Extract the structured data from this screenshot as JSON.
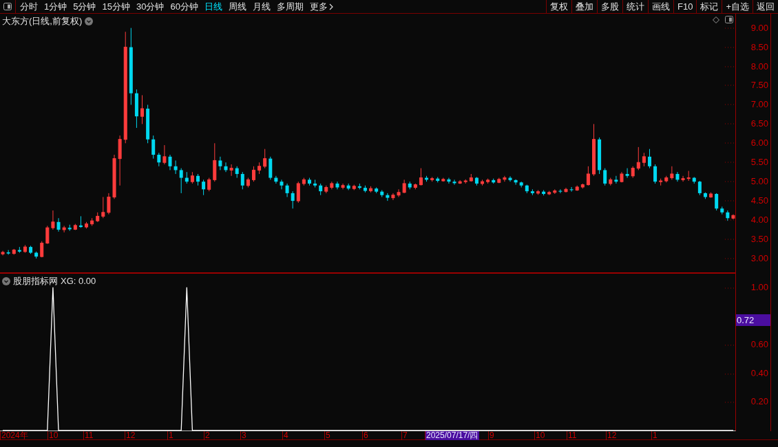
{
  "toolbar": {
    "periods": [
      {
        "label": "分时",
        "selected": false
      },
      {
        "label": "1分钟",
        "selected": false
      },
      {
        "label": "5分钟",
        "selected": false
      },
      {
        "label": "15分钟",
        "selected": false
      },
      {
        "label": "30分钟",
        "selected": false
      },
      {
        "label": "60分钟",
        "selected": false
      },
      {
        "label": "日线",
        "selected": true
      },
      {
        "label": "周线",
        "selected": false
      },
      {
        "label": "月线",
        "selected": false
      },
      {
        "label": "多周期",
        "selected": false
      }
    ],
    "more": "更多",
    "actions": [
      "复权",
      "叠加",
      "多股",
      "统计",
      "画线",
      "F10",
      "标记",
      "+自选",
      "返回"
    ]
  },
  "chart": {
    "title": "大东方(日线,前复权)",
    "chart_data": {
      "type": "candlestick",
      "ylim": [
        2.64,
        9.37
      ],
      "categories": [
        null,
        null,
        null,
        null,
        null,
        null,
        null,
        null,
        null,
        null,
        null,
        null,
        null,
        null,
        null,
        null,
        null,
        null,
        null,
        null,
        null,
        null,
        null,
        null,
        null,
        null,
        null,
        null,
        null,
        null,
        null,
        null,
        null,
        null,
        null,
        null,
        null,
        null,
        null,
        null,
        null,
        null,
        null,
        null,
        null,
        null,
        null,
        null,
        null,
        null,
        null,
        null,
        null,
        null,
        null,
        null,
        null,
        null,
        null,
        null,
        null,
        null,
        null,
        null,
        null,
        null,
        null,
        null,
        null,
        null,
        null,
        null,
        null,
        null,
        null,
        null,
        null,
        null,
        null,
        null,
        null,
        null,
        null,
        null,
        null,
        null,
        null,
        null,
        null,
        null,
        null,
        null,
        null,
        null,
        null,
        null,
        null,
        null,
        null,
        null,
        null,
        null,
        null,
        null,
        null,
        null,
        null,
        null,
        null,
        null,
        null,
        null,
        null,
        null,
        null,
        null,
        null,
        null,
        null,
        null,
        null,
        null,
        null,
        null,
        null,
        null,
        null,
        null,
        null,
        null,
        null,
        null
      ],
      "yticks": [
        {
          "value": 9,
          "label": "9.00"
        },
        {
          "value": 8.5,
          "label": "8.50"
        },
        {
          "value": 8,
          "label": "8.00"
        },
        {
          "value": 7.5,
          "label": "7.50"
        },
        {
          "value": 7,
          "label": "7.00"
        },
        {
          "value": 6.5,
          "label": "6.50"
        },
        {
          "value": 6,
          "label": "6.00"
        },
        {
          "value": 5.5,
          "label": "5.50"
        },
        {
          "value": 5,
          "label": "5.00"
        },
        {
          "value": 4.5,
          "label": "4.50"
        },
        {
          "value": 4,
          "label": "4.00"
        },
        {
          "value": 3.5,
          "label": "3.50"
        },
        {
          "value": 3,
          "label": "3.00"
        }
      ],
      "ohlc": [
        [
          3.12,
          3.2,
          3.08,
          3.16
        ],
        [
          3.16,
          3.22,
          3.1,
          3.13
        ],
        [
          3.13,
          3.25,
          3.1,
          3.22
        ],
        [
          3.22,
          3.3,
          3.15,
          3.18
        ],
        [
          3.18,
          3.35,
          3.15,
          3.3
        ],
        [
          3.3,
          3.33,
          3.12,
          3.15
        ],
        [
          3.15,
          3.18,
          3.0,
          3.05
        ],
        [
          3.05,
          3.45,
          3.03,
          3.4
        ],
        [
          3.4,
          3.85,
          3.38,
          3.8
        ],
        [
          3.8,
          4.25,
          3.75,
          3.95
        ],
        [
          3.95,
          4.05,
          3.7,
          3.75
        ],
        [
          3.75,
          3.85,
          3.68,
          3.8
        ],
        [
          3.8,
          3.88,
          3.72,
          3.76
        ],
        [
          3.76,
          3.9,
          3.74,
          3.86
        ],
        [
          3.86,
          4.1,
          3.8,
          3.82
        ],
        [
          3.82,
          3.95,
          3.78,
          3.9
        ],
        [
          3.9,
          4.05,
          3.85,
          3.98
        ],
        [
          3.98,
          4.2,
          3.95,
          4.1
        ],
        [
          4.1,
          4.6,
          4.05,
          4.2
        ],
        [
          4.2,
          4.7,
          4.15,
          4.6
        ],
        [
          4.6,
          5.7,
          4.55,
          5.6
        ],
        [
          5.6,
          6.2,
          4.9,
          6.1
        ],
        [
          6.1,
          8.9,
          6.0,
          8.5
        ],
        [
          8.5,
          9.0,
          7.0,
          7.3
        ],
        [
          7.3,
          7.4,
          6.4,
          6.7
        ],
        [
          6.7,
          7.25,
          6.5,
          6.9
        ],
        [
          6.9,
          7.0,
          6.0,
          6.1
        ],
        [
          6.1,
          6.2,
          5.6,
          5.7
        ],
        [
          5.7,
          5.75,
          5.4,
          5.5
        ],
        [
          5.5,
          5.95,
          5.45,
          5.65
        ],
        [
          5.65,
          5.7,
          5.3,
          5.4
        ],
        [
          5.4,
          5.55,
          5.2,
          5.3
        ],
        [
          5.3,
          5.35,
          4.7,
          5.1
        ],
        [
          5.1,
          5.25,
          4.95,
          5.0
        ],
        [
          5.0,
          5.25,
          4.95,
          5.15
        ],
        [
          5.15,
          5.2,
          4.9,
          5.0
        ],
        [
          5.0,
          5.05,
          4.65,
          4.8
        ],
        [
          4.8,
          5.1,
          4.75,
          5.05
        ],
        [
          5.05,
          6.0,
          5.0,
          5.55
        ],
        [
          5.55,
          5.65,
          5.3,
          5.4
        ],
        [
          5.4,
          5.5,
          5.25,
          5.3
        ],
        [
          5.3,
          5.45,
          5.15,
          5.35
        ],
        [
          5.35,
          5.4,
          5.1,
          5.2
        ],
        [
          5.2,
          5.25,
          4.8,
          4.9
        ],
        [
          4.9,
          5.1,
          4.85,
          5.05
        ],
        [
          5.05,
          5.4,
          5.0,
          5.3
        ],
        [
          5.3,
          5.5,
          5.2,
          5.4
        ],
        [
          5.4,
          5.85,
          5.35,
          5.6
        ],
        [
          5.6,
          5.65,
          5.05,
          5.1
        ],
        [
          5.1,
          5.15,
          4.95,
          5.0
        ],
        [
          5.0,
          5.05,
          4.8,
          4.9
        ],
        [
          4.9,
          4.95,
          4.6,
          4.7
        ],
        [
          4.7,
          4.75,
          4.3,
          4.5
        ],
        [
          4.5,
          5.0,
          4.45,
          4.95
        ],
        [
          4.95,
          5.1,
          4.9,
          5.05
        ],
        [
          5.05,
          5.1,
          4.9,
          4.95
        ],
        [
          4.95,
          5.05,
          4.85,
          4.9
        ],
        [
          4.9,
          4.95,
          4.65,
          4.75
        ],
        [
          4.75,
          4.9,
          4.7,
          4.85
        ],
        [
          4.85,
          5.0,
          4.8,
          4.95
        ],
        [
          4.95,
          5.0,
          4.8,
          4.85
        ],
        [
          4.85,
          4.95,
          4.8,
          4.9
        ],
        [
          4.9,
          4.95,
          4.78,
          4.82
        ],
        [
          4.82,
          4.92,
          4.78,
          4.88
        ],
        [
          4.88,
          4.95,
          4.8,
          4.84
        ],
        [
          4.84,
          4.9,
          4.72,
          4.76
        ],
        [
          4.76,
          4.88,
          4.72,
          4.82
        ],
        [
          4.82,
          4.85,
          4.7,
          4.74
        ],
        [
          4.74,
          4.78,
          4.6,
          4.65
        ],
        [
          4.65,
          4.7,
          4.5,
          4.58
        ],
        [
          4.58,
          4.7,
          4.52,
          4.65
        ],
        [
          4.65,
          4.8,
          4.6,
          4.72
        ],
        [
          4.72,
          5.05,
          4.7,
          4.95
        ],
        [
          4.95,
          5.0,
          4.8,
          4.85
        ],
        [
          4.85,
          4.95,
          4.8,
          4.92
        ],
        [
          4.92,
          5.35,
          4.9,
          5.1
        ],
        [
          5.1,
          5.15,
          5.0,
          5.05
        ],
        [
          5.05,
          5.12,
          5.0,
          5.08
        ],
        [
          5.08,
          5.12,
          4.98,
          5.02
        ],
        [
          5.02,
          5.1,
          5.0,
          5.06
        ],
        [
          5.06,
          5.1,
          4.95,
          5.0
        ],
        [
          5.0,
          5.05,
          4.92,
          4.96
        ],
        [
          4.96,
          5.04,
          4.94,
          5.0
        ],
        [
          5.0,
          5.06,
          4.95,
          5.02
        ],
        [
          5.02,
          5.2,
          5.0,
          5.1
        ],
        [
          5.1,
          5.12,
          4.9,
          4.95
        ],
        [
          4.95,
          5.05,
          4.9,
          5.0
        ],
        [
          5.0,
          5.08,
          4.95,
          5.04
        ],
        [
          5.04,
          5.08,
          4.95,
          4.98
        ],
        [
          4.98,
          5.1,
          4.96,
          5.06
        ],
        [
          5.06,
          5.15,
          5.0,
          5.1
        ],
        [
          5.1,
          5.14,
          5.0,
          5.04
        ],
        [
          5.04,
          5.06,
          4.92,
          4.98
        ],
        [
          4.98,
          5.0,
          4.85,
          4.9
        ],
        [
          4.9,
          4.92,
          4.7,
          4.75
        ],
        [
          4.75,
          4.8,
          4.65,
          4.7
        ],
        [
          4.7,
          4.78,
          4.66,
          4.74
        ],
        [
          4.74,
          4.78,
          4.64,
          4.68
        ],
        [
          4.68,
          4.76,
          4.65,
          4.72
        ],
        [
          4.72,
          4.8,
          4.68,
          4.76
        ],
        [
          4.76,
          4.8,
          4.7,
          4.74
        ],
        [
          4.74,
          4.84,
          4.72,
          4.8
        ],
        [
          4.8,
          4.86,
          4.74,
          4.78
        ],
        [
          4.78,
          4.9,
          4.76,
          4.86
        ],
        [
          4.86,
          4.95,
          4.82,
          4.92
        ],
        [
          4.92,
          5.4,
          4.9,
          5.2
        ],
        [
          5.2,
          6.5,
          5.15,
          6.1
        ],
        [
          6.1,
          6.15,
          5.2,
          5.3
        ],
        [
          5.3,
          5.35,
          4.9,
          4.95
        ],
        [
          4.95,
          5.1,
          4.9,
          5.05
        ],
        [
          5.05,
          5.15,
          4.95,
          5.0
        ],
        [
          5.0,
          5.25,
          4.98,
          5.2
        ],
        [
          5.2,
          5.35,
          5.1,
          5.15
        ],
        [
          5.15,
          5.4,
          5.1,
          5.35
        ],
        [
          5.35,
          5.9,
          5.3,
          5.5
        ],
        [
          5.5,
          5.75,
          5.4,
          5.65
        ],
        [
          5.65,
          5.85,
          5.35,
          5.4
        ],
        [
          5.4,
          5.45,
          4.95,
          5.0
        ],
        [
          5.0,
          5.08,
          4.9,
          5.02
        ],
        [
          5.02,
          5.15,
          4.98,
          5.1
        ],
        [
          5.1,
          5.4,
          5.05,
          5.2
        ],
        [
          5.2,
          5.25,
          5.0,
          5.05
        ],
        [
          5.05,
          5.15,
          5.0,
          5.08
        ],
        [
          5.08,
          5.28,
          5.02,
          5.1
        ],
        [
          5.1,
          5.12,
          4.95,
          5.0
        ],
        [
          5.0,
          5.02,
          4.65,
          4.7
        ],
        [
          4.7,
          4.72,
          4.55,
          4.6
        ],
        [
          4.6,
          4.72,
          4.58,
          4.68
        ],
        [
          4.68,
          4.7,
          4.25,
          4.3
        ],
        [
          4.3,
          4.35,
          4.15,
          4.2
        ],
        [
          4.2,
          4.25,
          3.98,
          4.05
        ],
        [
          4.05,
          4.15,
          4.02,
          4.12
        ]
      ]
    }
  },
  "indicator": {
    "name": "股朋指标网",
    "readout": "XG: 0.00",
    "cursor_value": "0.72",
    "chart_data": {
      "type": "line",
      "ylim": [
        0,
        1.095
      ],
      "yticks": [
        {
          "value": 1,
          "label": "1.00"
        },
        {
          "value": 0.6,
          "label": "0.60"
        },
        {
          "value": 0.4,
          "label": "0.40"
        },
        {
          "value": 0.2,
          "label": "0.20"
        }
      ],
      "series": [
        {
          "color": "#ffffff",
          "values": [
            0,
            0,
            0,
            0,
            0,
            0,
            0,
            0,
            0,
            1,
            0,
            0,
            0,
            0,
            0,
            0,
            0,
            0,
            0,
            0,
            0,
            0,
            0,
            0,
            0,
            0,
            0,
            0,
            0,
            0,
            0,
            0,
            0,
            1,
            0,
            0,
            0,
            0,
            0,
            0,
            0,
            0,
            0,
            0,
            0,
            0,
            0,
            0,
            0,
            0,
            0,
            0,
            0,
            0,
            0,
            0,
            0,
            0,
            0,
            0,
            0,
            0,
            0,
            0,
            0,
            0,
            0,
            0,
            0,
            0,
            0,
            0,
            0,
            0,
            0,
            0,
            0,
            0,
            0,
            0,
            0,
            0,
            0,
            0,
            0,
            0,
            0,
            0,
            0,
            0,
            0,
            0,
            0,
            0,
            0,
            0,
            0,
            0,
            0,
            0,
            0,
            0,
            0,
            0,
            0,
            0,
            0,
            0,
            0,
            0,
            0,
            0,
            0,
            0,
            0,
            0,
            0,
            0,
            0,
            0,
            0,
            0,
            0,
            0,
            0,
            0,
            0,
            0,
            0,
            0,
            0,
            0
          ]
        }
      ]
    }
  },
  "date_axis": {
    "labels": [
      {
        "text": "2024年",
        "selected": false
      },
      {
        "text": "10",
        "selected": false
      },
      {
        "text": "11",
        "selected": false
      },
      {
        "text": "12",
        "selected": false
      },
      {
        "text": "1",
        "selected": false
      },
      {
        "text": "2",
        "selected": false
      },
      {
        "text": "3",
        "selected": false
      },
      {
        "text": "4",
        "selected": false
      },
      {
        "text": "5",
        "selected": false
      },
      {
        "text": "6",
        "selected": false
      },
      {
        "text": "7",
        "selected": false
      },
      {
        "text": "2025/07/17/四",
        "selected": true
      },
      {
        "text": "9",
        "selected": false
      },
      {
        "text": "10",
        "selected": false
      },
      {
        "text": "11",
        "selected": false
      },
      {
        "text": "12",
        "selected": false
      },
      {
        "text": "1",
        "selected": false
      }
    ]
  }
}
